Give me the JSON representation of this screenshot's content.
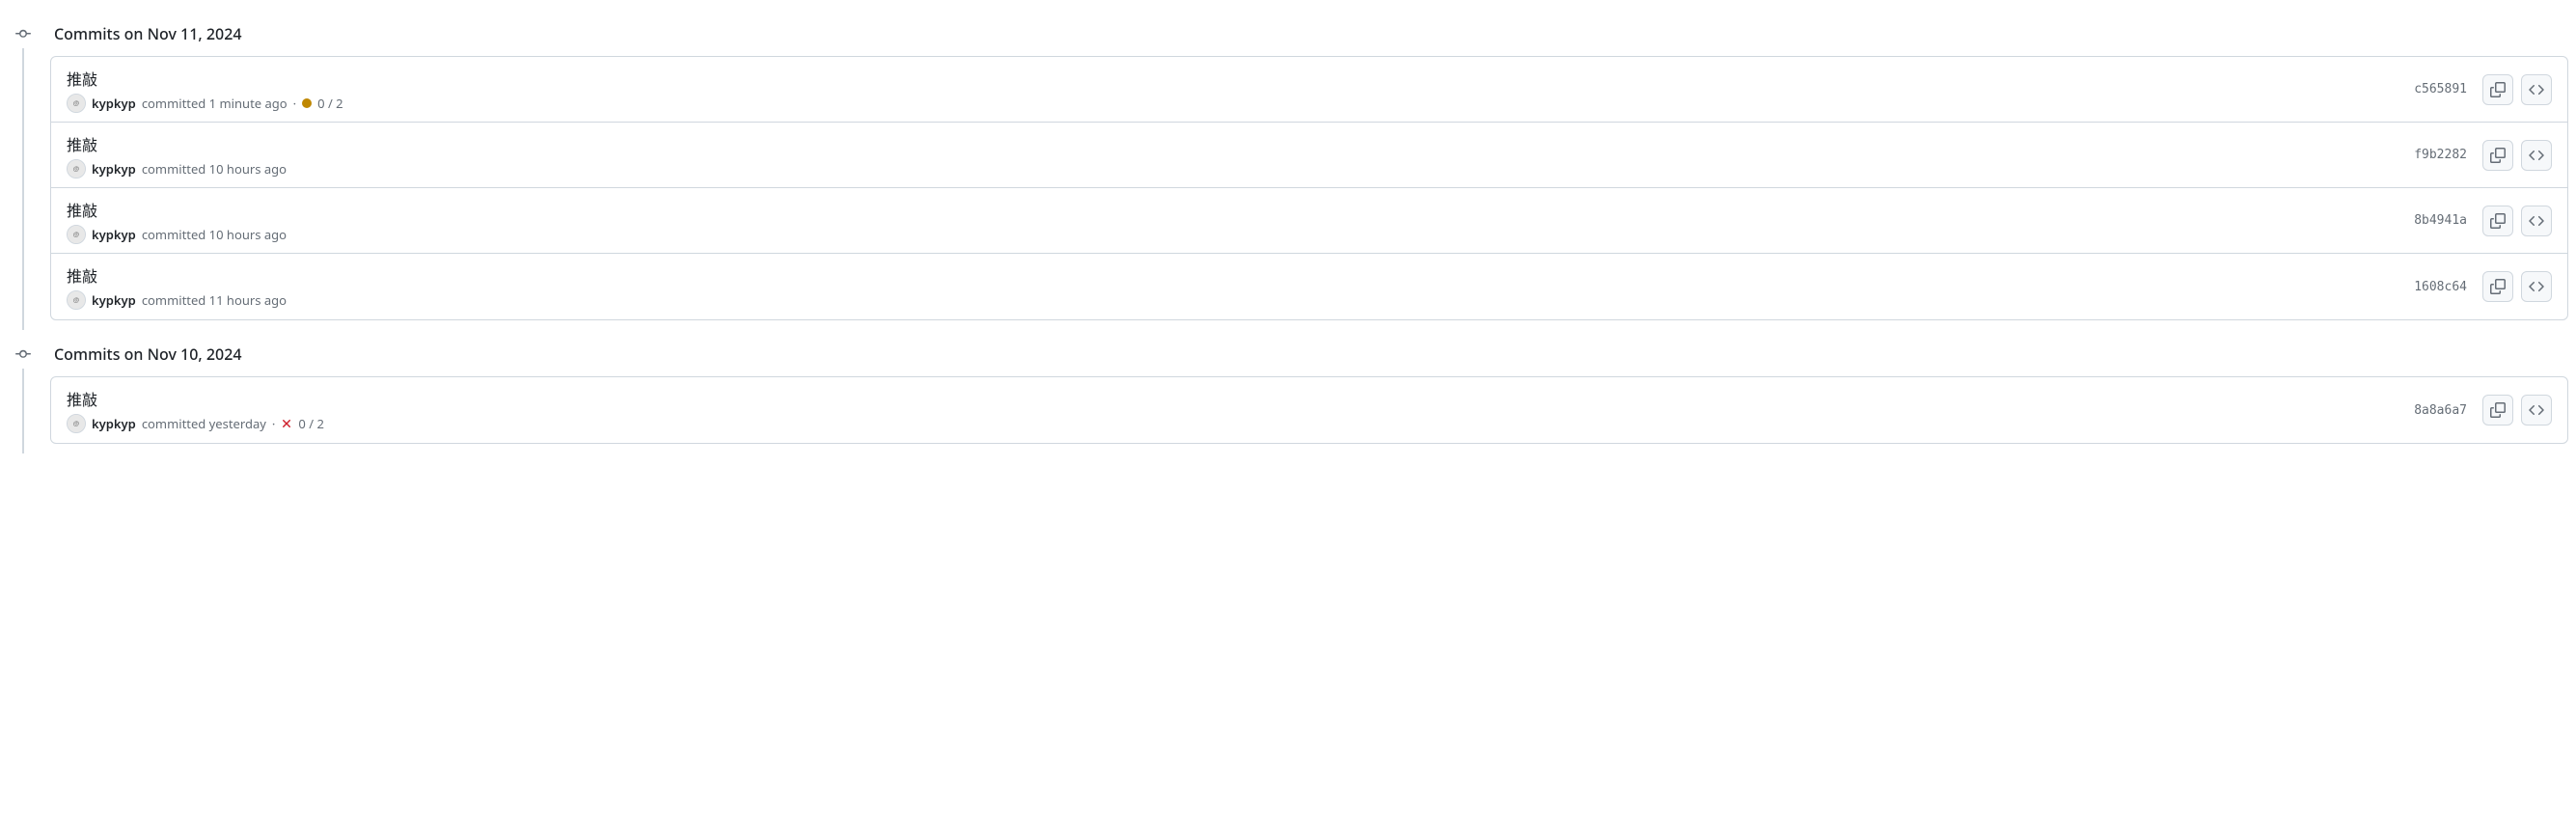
{
  "groups": [
    {
      "date_label": "Commits on Nov 11, 2024",
      "commits": [
        {
          "title": "推敲",
          "author": "kypkyp",
          "time_text": "committed 1 minute ago",
          "status": "pending",
          "checks": "0 / 2",
          "sha": "c565891"
        },
        {
          "title": "推敲",
          "author": "kypkyp",
          "time_text": "committed 10 hours ago",
          "status": null,
          "checks": null,
          "sha": "f9b2282"
        },
        {
          "title": "推敲",
          "author": "kypkyp",
          "time_text": "committed 10 hours ago",
          "status": null,
          "checks": null,
          "sha": "8b4941a"
        },
        {
          "title": "推敲",
          "author": "kypkyp",
          "time_text": "committed 11 hours ago",
          "status": null,
          "checks": null,
          "sha": "1608c64"
        }
      ]
    },
    {
      "date_label": "Commits on Nov 10, 2024",
      "commits": [
        {
          "title": "推敲",
          "author": "kypkyp",
          "time_text": "committed yesterday",
          "status": "fail",
          "checks": "0 / 2",
          "sha": "8a8a6a7"
        }
      ]
    }
  ]
}
